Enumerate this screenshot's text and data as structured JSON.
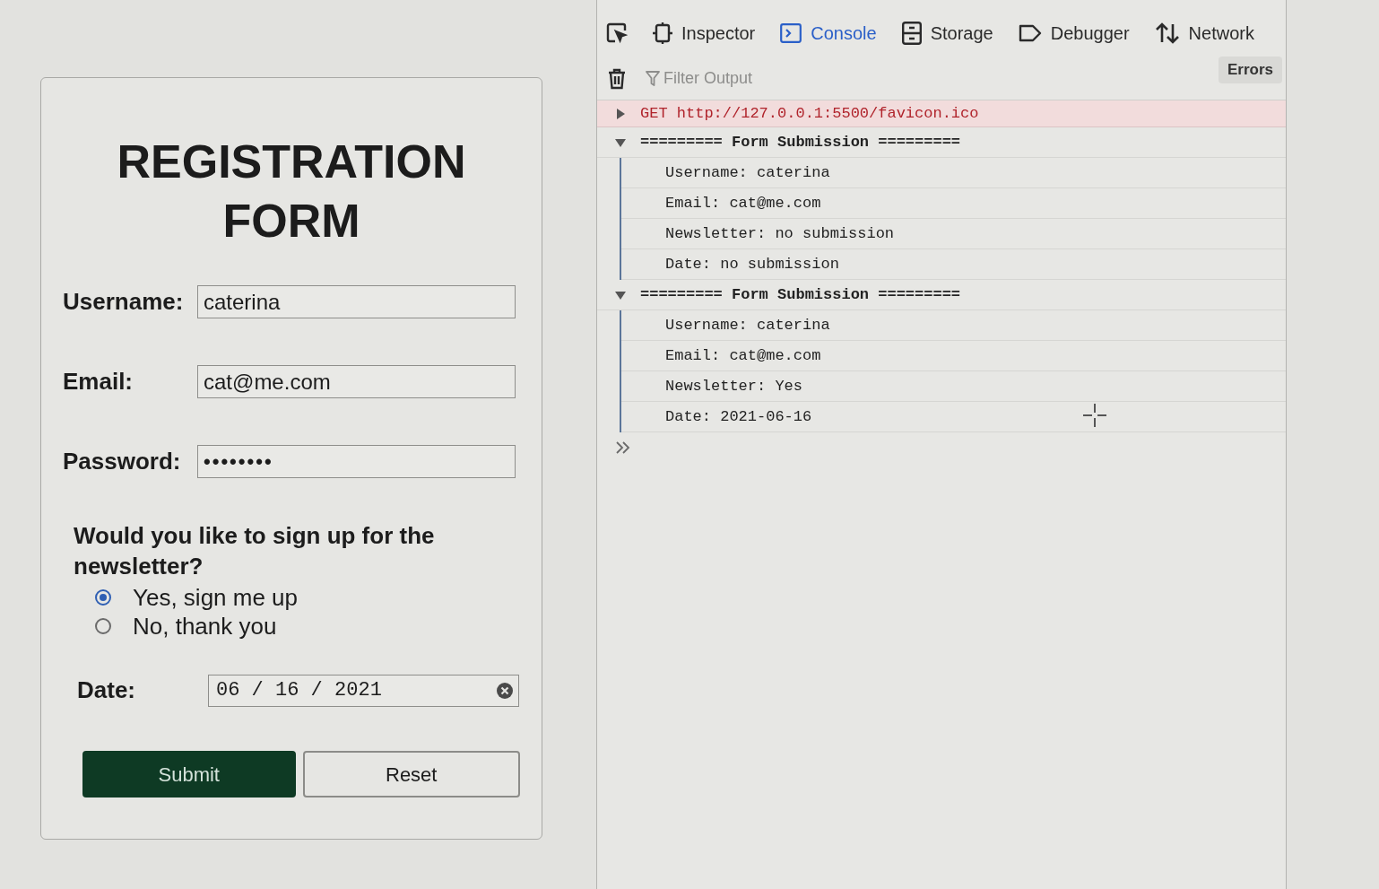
{
  "form": {
    "title": "REGISTRATION FORM",
    "fields": [
      {
        "kind": "text",
        "label": "Username:",
        "value": "caterina"
      },
      {
        "kind": "text",
        "label": "Email:",
        "value": "cat@me.com"
      },
      {
        "kind": "password",
        "label": "Password:",
        "value": "••••••••"
      }
    ],
    "newsletter": {
      "question": "Would you like to sign up for the newsletter?",
      "options": [
        {
          "label": "Yes, sign me up",
          "selected": true
        },
        {
          "label": "No, thank you",
          "selected": false
        }
      ]
    },
    "date": {
      "label": "Date:",
      "value": "06 / 16 / 2021"
    },
    "buttons": [
      {
        "kind": "primary",
        "label": "Submit"
      },
      {
        "kind": "secondary",
        "label": "Reset"
      }
    ]
  },
  "devtools": {
    "tabs": [
      {
        "label": "Inspector",
        "selected": false
      },
      {
        "label": "Console",
        "selected": true
      },
      {
        "label": "Storage",
        "selected": false
      },
      {
        "label": "Debugger",
        "selected": false
      },
      {
        "label": "Network",
        "selected": false
      }
    ],
    "filter": {
      "placeholder": "Filter Output"
    },
    "errors_button": "Errors",
    "console": [
      {
        "kind": "request",
        "text": "GET http://127.0.0.1:5500/favicon.ico",
        "expanded": false
      },
      {
        "kind": "group",
        "header": "========= Form Submission =========",
        "expanded": true,
        "lines": [
          "Username: caterina",
          "Email: cat@me.com",
          "Newsletter: no submission",
          "Date: no submission"
        ]
      },
      {
        "kind": "group",
        "header": "========= Form Submission =========",
        "expanded": true,
        "lines": [
          "Username: caterina",
          "Email: cat@me.com",
          "Newsletter: Yes",
          "Date: 2021-06-16"
        ]
      }
    ]
  }
}
